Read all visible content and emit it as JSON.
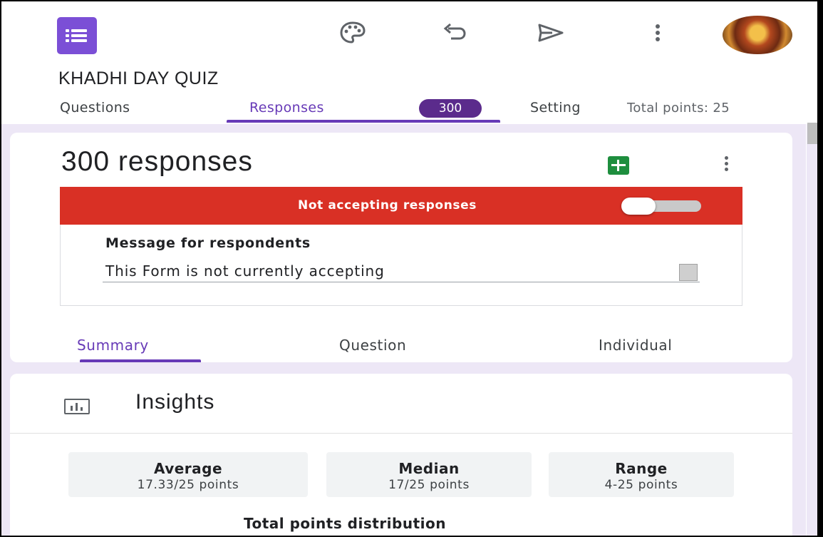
{
  "header": {
    "form_title": "KHADHI DAY QUIZ",
    "icons": [
      "forms-logo-icon",
      "palette-icon",
      "undo-icon",
      "send-icon",
      "more-vert-icon",
      "avatar"
    ]
  },
  "tabs": {
    "questions": "Questions",
    "responses": "Responses",
    "responses_badge": "300",
    "settings": "Setting",
    "total_points": "Total points: 25"
  },
  "responses_card": {
    "count_label": "300 responses",
    "banner_text": "Not accepting responses",
    "accepting": false,
    "message_label": "Message for respondents",
    "message_value": "This Form is not currently accepting"
  },
  "subtabs": {
    "summary": "Summary",
    "question": "Question",
    "individual": "Individual"
  },
  "insights": {
    "title": "Insights",
    "average_label": "Average",
    "average_value": "17.33/25 points",
    "median_label": "Median",
    "median_value": "17/25 points",
    "range_label": "Range",
    "range_value": "4-25 points",
    "distribution_title": "Total points distribution"
  },
  "colors": {
    "accent": "#673ab7",
    "badge": "#5b2b8c",
    "banner_red": "#d93025",
    "sheets_green": "#1e8e3e",
    "background": "#ede7f6"
  }
}
